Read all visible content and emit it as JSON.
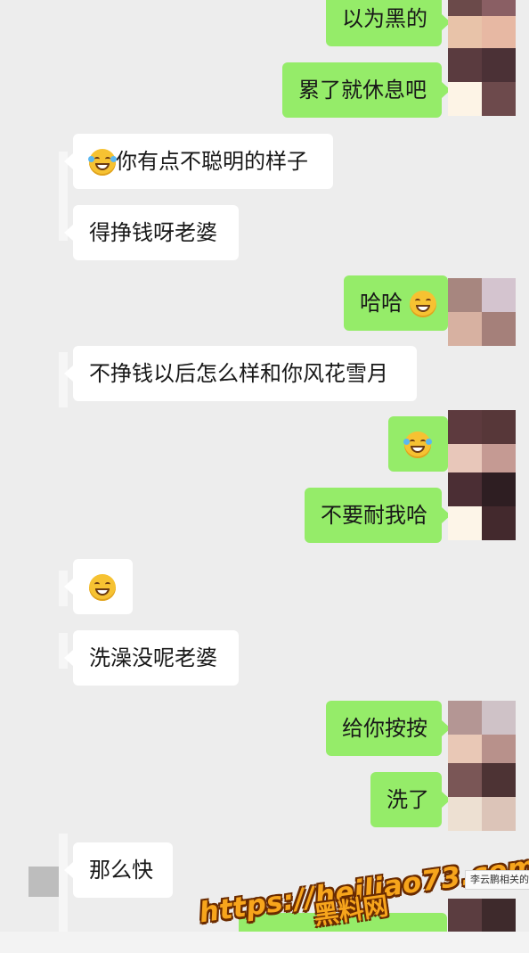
{
  "chat": {
    "messages": [
      {
        "side": "out",
        "text": "以为黑的"
      },
      {
        "side": "out",
        "text": "累了就休息吧"
      },
      {
        "side": "in",
        "emoji": "laugh-cry-emoji",
        "text": "你有点不聪明的样子"
      },
      {
        "side": "in",
        "text": "得挣钱呀老婆"
      },
      {
        "side": "out",
        "text": "哈哈",
        "emoji_after": "grin-emoji"
      },
      {
        "side": "in",
        "text": "不挣钱以后怎么样和你风花雪月"
      },
      {
        "side": "out",
        "emoji": "laugh-cry-emoji",
        "text": ""
      },
      {
        "side": "out",
        "text": "不要耐我哈"
      },
      {
        "side": "in",
        "emoji": "grin-emoji",
        "text": ""
      },
      {
        "side": "in",
        "text": "洗澡没呢老婆"
      },
      {
        "side": "out",
        "text": "给你按按"
      },
      {
        "side": "out",
        "text": "洗了"
      },
      {
        "side": "in",
        "text": "那么快"
      }
    ]
  },
  "watermark": {
    "url": "https://heiliao73.com",
    "name": "黑料网"
  },
  "side_tag": "李云鹏相关的",
  "colors": {
    "background": "#ededed",
    "incoming_bubble": "#ffffff",
    "outgoing_bubble": "#95ec69",
    "watermark": "#f7a51c"
  }
}
